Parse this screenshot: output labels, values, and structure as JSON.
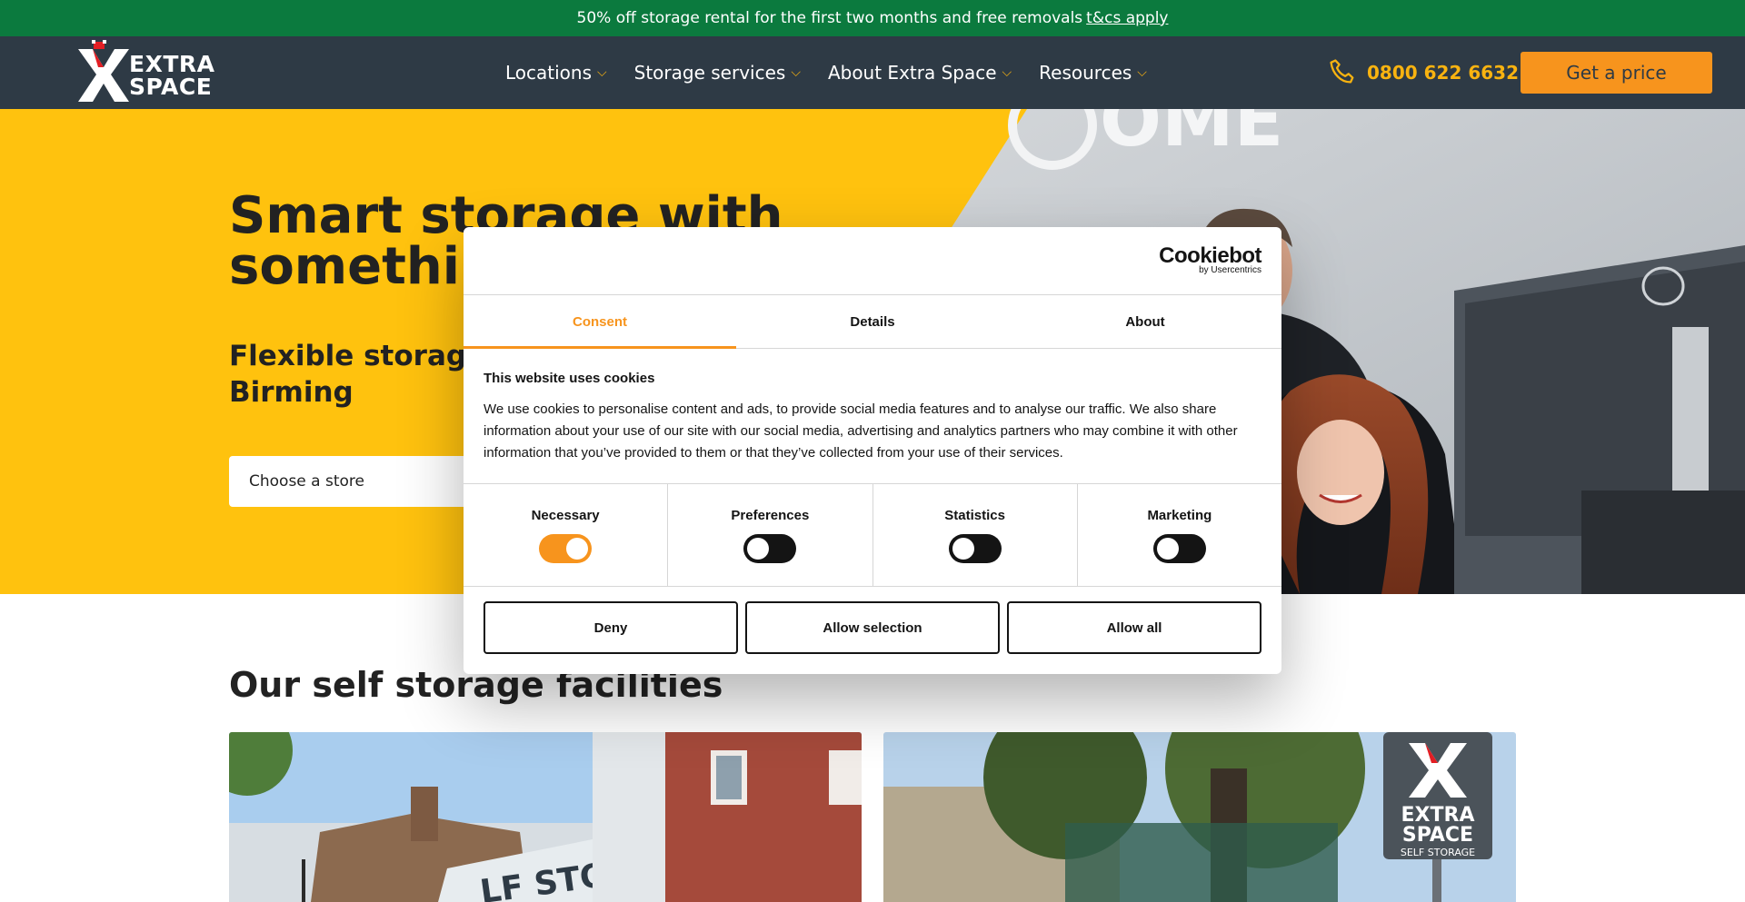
{
  "promo": {
    "text": "50% off storage rental for the first two months and free removals",
    "link": "t&cs apply"
  },
  "header": {
    "logo_line1": "EXTRA",
    "logo_line2": "SPACE",
    "nav": [
      {
        "label": "Locations"
      },
      {
        "label": "Storage services"
      },
      {
        "label": "About Extra Space"
      },
      {
        "label": "Resources"
      }
    ],
    "phone": "0800 622 6632",
    "cta": "Get a price"
  },
  "hero": {
    "title": "Smart storage with something",
    "subtitle": "Flexible storage s London & Birming",
    "store_select": "Choose a store"
  },
  "section": {
    "title": "Our self storage facilities"
  },
  "cards": [
    {
      "sign": "LF STORAGE"
    },
    {
      "sign1": "EXTRA",
      "sign2": "SPACE",
      "sign3": "SELF STORAGE"
    }
  ],
  "cookie_dialog": {
    "brand": "Cookiebot",
    "brand_sub": "by Usercentrics",
    "tabs": [
      {
        "label": "Consent",
        "active": true
      },
      {
        "label": "Details",
        "active": false
      },
      {
        "label": "About",
        "active": false
      }
    ],
    "heading": "This website uses cookies",
    "body": "We use cookies to personalise content and ads, to provide social media features and to analyse our traffic. We also share information about your use of our site with our social media, advertising and analytics partners who may combine it with other information that you’ve provided to them or that they’ve collected from your use of their services.",
    "toggles": [
      {
        "label": "Necessary",
        "on": true
      },
      {
        "label": "Preferences",
        "on": false
      },
      {
        "label": "Statistics",
        "on": false
      },
      {
        "label": "Marketing",
        "on": false
      }
    ],
    "buttons": {
      "deny": "Deny",
      "allow_selection": "Allow selection",
      "allow_all": "Allow all"
    }
  },
  "colors": {
    "promo_bg": "#0b7a3e",
    "header_bg": "#2e3a45",
    "hero_yellow": "#ffc20e",
    "accent_orange": "#f7941d",
    "phone_gold": "#f9b310"
  }
}
